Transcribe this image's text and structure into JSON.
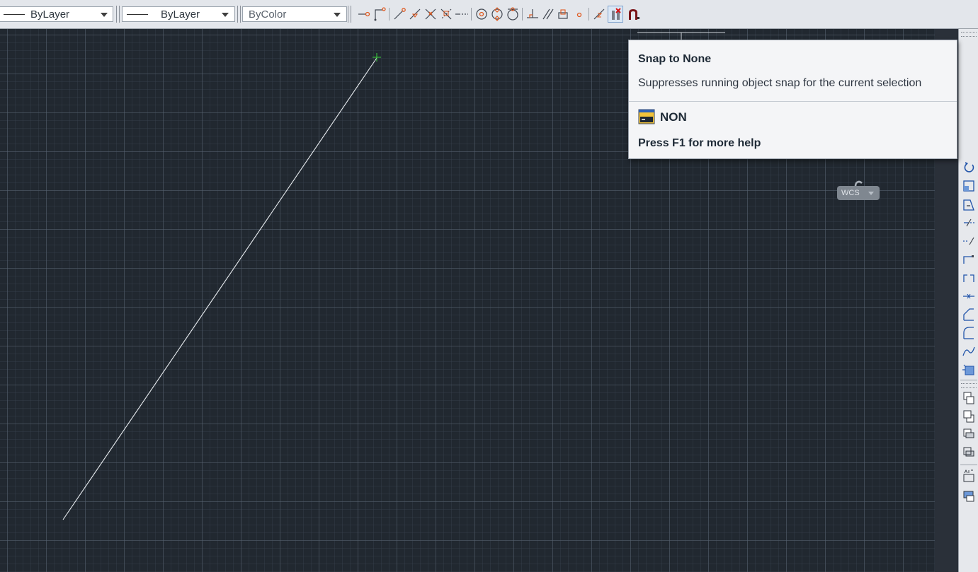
{
  "properties_toolbar": {
    "linetype_value": "ByLayer",
    "lineweight_value": "ByLayer",
    "plotstyle_value": "ByColor"
  },
  "osnap_toolbar": {
    "buttons": [
      "temporary-tracking-point-icon",
      "snap-from-icon",
      "snap-to-endpoint-icon",
      "snap-to-midpoint-icon",
      "snap-to-intersection-icon",
      "snap-to-apparent-intersection-icon",
      "snap-to-extension-icon",
      "snap-to-center-icon",
      "snap-to-quadrant-icon",
      "snap-to-tangent-icon",
      "snap-to-perpendicular-icon",
      "snap-to-parallel-icon",
      "snap-to-insert-icon",
      "snap-to-node-icon",
      "snap-to-nearest-icon",
      "snap-to-none-icon",
      "osnap-settings-icon"
    ],
    "hovered": "snap-to-none-icon"
  },
  "tooltip": {
    "title": "Snap to None",
    "description": "Suppresses running object snap for the current selection",
    "command": "NON",
    "help": "Press F1 for more help"
  },
  "viewport": {
    "ucs_label": "WCS",
    "background_color": "#212830",
    "line_color": "#e8ecf0",
    "crosshair_color": "#3cd23c"
  },
  "right_toolbar": {
    "buttons": [
      "rotate-icon",
      "scale-icon",
      "stretch-icon",
      "trim-icon",
      "extend-icon",
      "break-at-point-icon",
      "break-icon",
      "join-icon",
      "chamfer-icon",
      "fillet-icon",
      "blend-curves-icon",
      "explode-icon",
      "bring-to-front-icon",
      "send-to-back-icon",
      "bring-above-objects-icon",
      "send-under-objects-icon",
      "bring-text-to-front-icon",
      "bring-all-annotations-to-front-icon"
    ]
  }
}
